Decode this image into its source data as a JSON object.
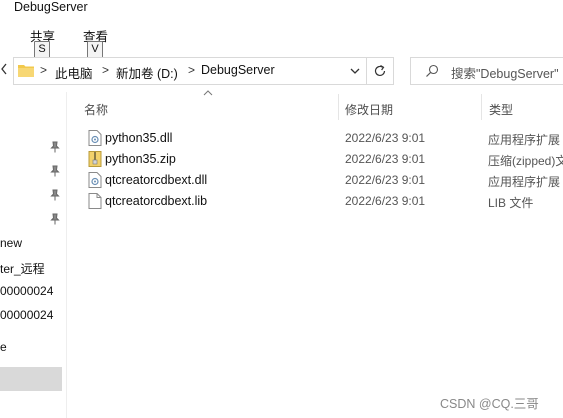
{
  "window": {
    "title": "DebugServer"
  },
  "ribbon": {
    "tabs": [
      {
        "label": "共享",
        "key": "S"
      },
      {
        "label": "查看",
        "key": "V"
      }
    ]
  },
  "address_bar": {
    "crumbs": [
      "此电脑",
      "新加卷 (D:)",
      "DebugServer"
    ],
    "separator": ">"
  },
  "search": {
    "placeholder": "搜索\"DebugServer\""
  },
  "nav_pane": {
    "items": [
      "new",
      "ter_远程",
      "00000024",
      "00000024",
      "e"
    ]
  },
  "columns": {
    "name": "名称",
    "modified": "修改日期",
    "type": "类型"
  },
  "files": [
    {
      "name": "python35.dll",
      "modified": "2022/6/23 9:01",
      "type": "应用程序扩展",
      "icon": "dll-file-icon"
    },
    {
      "name": "python35.zip",
      "modified": "2022/6/23 9:01",
      "type": "压缩(zipped)文件夹",
      "icon": "zip-file-icon"
    },
    {
      "name": "qtcreatorcdbext.dll",
      "modified": "2022/6/23 9:01",
      "type": "应用程序扩展",
      "icon": "dll-file-icon"
    },
    {
      "name": "qtcreatorcdbext.lib",
      "modified": "2022/6/23 9:01",
      "type": "LIB 文件",
      "icon": "blank-file-icon"
    }
  ],
  "watermark": "CSDN @CQ.三哥",
  "colors": {
    "folder": "#f2c94c",
    "border": "#d9d9d9",
    "selected": "#d9d9d9"
  }
}
